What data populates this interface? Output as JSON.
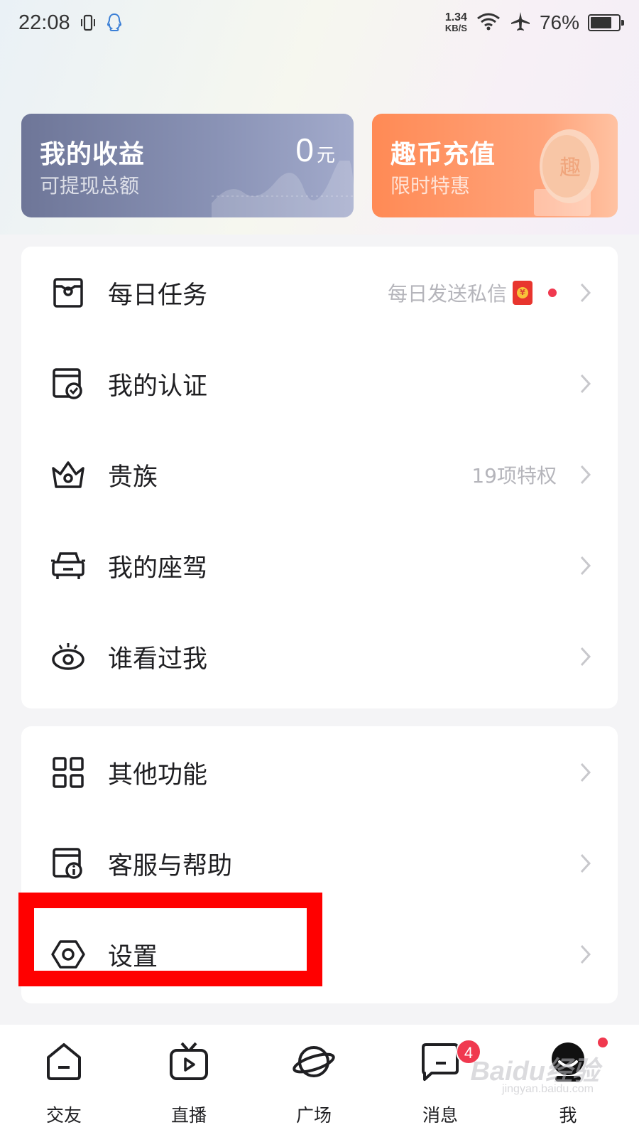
{
  "status_bar": {
    "time": "22:08",
    "net_speed": "1.34",
    "net_unit": "KB/S",
    "battery": "76%",
    "battery_level": 0.76
  },
  "cards": {
    "earnings": {
      "title": "我的收益",
      "subtitle": "可提现总额",
      "amount": "0",
      "unit": "元"
    },
    "recharge": {
      "title": "趣币充值",
      "subtitle": "限时特惠"
    }
  },
  "menu_main": [
    {
      "label": "每日任务",
      "hint": "每日发送私信",
      "icon": "task-calendar-icon"
    },
    {
      "label": "我的认证",
      "hint": "",
      "icon": "certification-icon"
    },
    {
      "label": "贵族",
      "hint": "19项特权",
      "icon": "crown-icon"
    },
    {
      "label": "我的座驾",
      "hint": "",
      "icon": "car-icon"
    },
    {
      "label": "谁看过我",
      "hint": "",
      "icon": "eye-icon"
    }
  ],
  "menu_other": [
    {
      "label": "其他功能",
      "icon": "grid-icon"
    },
    {
      "label": "客服与帮助",
      "icon": "help-info-icon"
    },
    {
      "label": "设置",
      "icon": "settings-hex-icon"
    }
  ],
  "bottom_nav": [
    {
      "label": "交友",
      "icon": "home-icon"
    },
    {
      "label": "直播",
      "icon": "tv-play-icon"
    },
    {
      "label": "广场",
      "icon": "planet-icon"
    },
    {
      "label": "消息",
      "icon": "message-icon",
      "badge": "4"
    },
    {
      "label": "我",
      "icon": "profile-icon"
    }
  ],
  "watermark": {
    "text": "Baidu经验",
    "sub": "jingyan.baidu.com"
  },
  "colors": {
    "accent_red": "#f0394f",
    "highlight": "#ff0000",
    "earn_card": "#7b83a6",
    "recharge_card": "#ff9463"
  }
}
